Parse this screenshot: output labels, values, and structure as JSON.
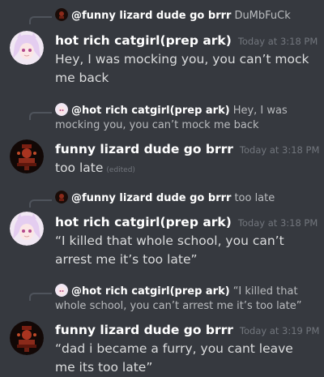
{
  "messages": [
    {
      "reply": {
        "author": "@funny lizard dude go brrr",
        "text": "DuMbFuCk"
      },
      "author": "hot rich catgirl(prep ark)",
      "timestamp": "Today at 3:18 PM",
      "text": "Hey, I was mocking you, you can’t mock me back"
    },
    {
      "reply": {
        "author": "@hot rich catgirl(prep ark)",
        "text": "Hey, I was mocking you, you can’t mock me back"
      },
      "author": "funny lizard dude go brrr",
      "timestamp": "Today at 3:18 PM",
      "text": "too late",
      "edited": "(edited)"
    },
    {
      "reply": {
        "author": "@funny lizard dude go brrr",
        "text": "too late"
      },
      "author": "hot rich catgirl(prep ark)",
      "timestamp": "Today at 3:18 PM",
      "text": "“I killed that whole school, you can’t arrest me it’s too late”"
    },
    {
      "reply": {
        "author": "@hot rich catgirl(prep ark)",
        "text": "“I killed that whole school, you can’t arrest me it’s too late”"
      },
      "author": "funny lizard dude go brrr",
      "timestamp": "Today at 3:19 PM",
      "text": "“dad i became a furry, you cant leave me its too late”"
    }
  ],
  "avatars": {
    "catgirl": "catgirl-avatar",
    "lizard": "lizard-avatar"
  },
  "colors": {
    "background": "#36393f",
    "username": "#ffffff",
    "timestamp": "#72767d",
    "message_text": "#dcddde",
    "reply_text": "#b9bbbe"
  }
}
